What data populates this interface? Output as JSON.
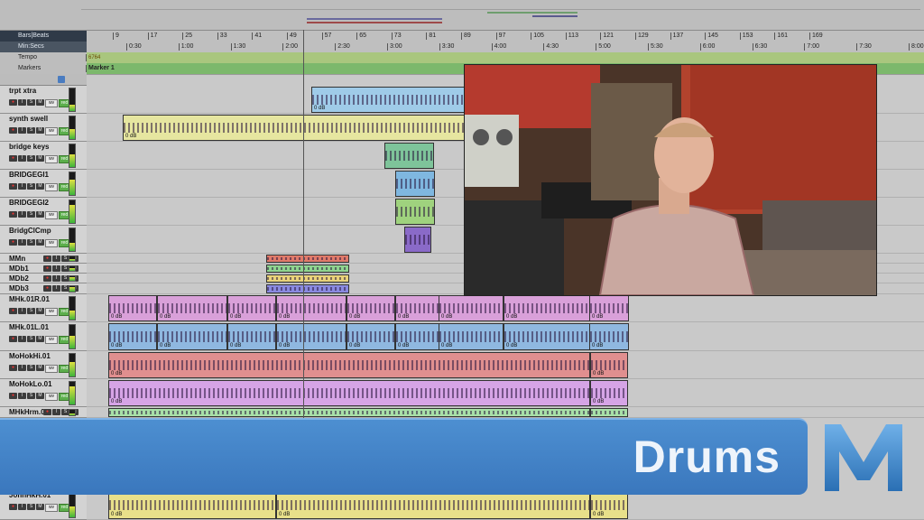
{
  "rulers": {
    "bars_label": "Bars|Beats",
    "minsecs_label": "Min:Secs",
    "tempo_label": "Tempo",
    "markers_label": "Markers",
    "bars_ticks": [
      "9",
      "17",
      "25",
      "33",
      "41",
      "49",
      "57",
      "65",
      "73",
      "81",
      "89",
      "97",
      "105",
      "113",
      "121",
      "129",
      "137",
      "145",
      "153",
      "161",
      "169"
    ],
    "minsecs_ticks": [
      "0:30",
      "1:00",
      "1:30",
      "2:00",
      "2:30",
      "3:00",
      "3:30",
      "4:00",
      "4:30",
      "5:00",
      "5:30",
      "6:00",
      "6:30",
      "7:00",
      "7:30",
      "8:00"
    ],
    "tempo_value": "6764",
    "marker_name": "Marker 1"
  },
  "tracks": [
    {
      "name": "trpt xtra",
      "clip_vol": "0 dB",
      "color": "#9fcbe8"
    },
    {
      "name": "synth swell",
      "clip_vol": "0 dB",
      "color": "#e6e6a0"
    },
    {
      "name": "bridge keys",
      "clip_vol": "",
      "color": "#7ec49a"
    },
    {
      "name": "BRIDGEGI1",
      "clip_vol": "",
      "color": "#7fb7e0"
    },
    {
      "name": "BRIDGEGI2",
      "clip_vol": "",
      "color": "#9fd27e"
    },
    {
      "name": "BridgClCmp",
      "clip_vol": "",
      "color": "#8a6ac8"
    },
    {
      "name": "MMn",
      "clip_vol": "",
      "color": "#e07a6a"
    },
    {
      "name": "MDb1",
      "clip_vol": "",
      "color": "#8fd48f"
    },
    {
      "name": "MDb2",
      "clip_vol": "",
      "color": "#e8d27a"
    },
    {
      "name": "MDb3",
      "clip_vol": "",
      "color": "#8a8ae0"
    },
    {
      "name": "MHk.01R.01",
      "clip_vol": "0 dB",
      "color": "#d9a0d9"
    },
    {
      "name": "MHk.01L.01",
      "clip_vol": "0 dB",
      "color": "#8fb8e0"
    },
    {
      "name": "MoHokHi.01",
      "clip_vol": "0 dB",
      "color": "#e08f8f"
    },
    {
      "name": "MoHokLo.01",
      "clip_vol": "0 dB",
      "color": "#d6a4e6"
    },
    {
      "name": "MHkHrm.01",
      "clip_vol": "",
      "color": "#a8e0a8"
    },
    {
      "name": "JohnHkH.01",
      "clip_vol": "0 dB",
      "color": "#e8e08a"
    }
  ],
  "track_buttons": {
    "rec": "●",
    "input": "I",
    "solo": "S",
    "mute": "M",
    "view": "wv",
    "auto": "red"
  },
  "banner": {
    "title": "Drums"
  },
  "colors": {
    "accent": "#3a77bd",
    "track_header": "#d3d3d3",
    "lane": "#c9c9c9"
  }
}
